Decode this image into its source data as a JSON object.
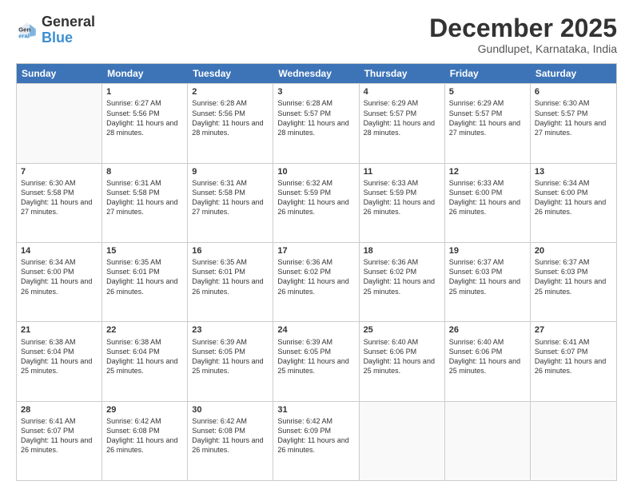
{
  "header": {
    "logo_general": "General",
    "logo_blue": "Blue",
    "month": "December 2025",
    "location": "Gundlupet, Karnataka, India"
  },
  "days_of_week": [
    "Sunday",
    "Monday",
    "Tuesday",
    "Wednesday",
    "Thursday",
    "Friday",
    "Saturday"
  ],
  "weeks": [
    [
      {
        "day": "",
        "empty": true
      },
      {
        "day": "1",
        "sunrise": "6:27 AM",
        "sunset": "5:56 PM",
        "daylight": "11 hours and 28 minutes."
      },
      {
        "day": "2",
        "sunrise": "6:28 AM",
        "sunset": "5:56 PM",
        "daylight": "11 hours and 28 minutes."
      },
      {
        "day": "3",
        "sunrise": "6:28 AM",
        "sunset": "5:57 PM",
        "daylight": "11 hours and 28 minutes."
      },
      {
        "day": "4",
        "sunrise": "6:29 AM",
        "sunset": "5:57 PM",
        "daylight": "11 hours and 28 minutes."
      },
      {
        "day": "5",
        "sunrise": "6:29 AM",
        "sunset": "5:57 PM",
        "daylight": "11 hours and 27 minutes."
      },
      {
        "day": "6",
        "sunrise": "6:30 AM",
        "sunset": "5:57 PM",
        "daylight": "11 hours and 27 minutes."
      }
    ],
    [
      {
        "day": "7",
        "sunrise": "6:30 AM",
        "sunset": "5:58 PM",
        "daylight": "11 hours and 27 minutes."
      },
      {
        "day": "8",
        "sunrise": "6:31 AM",
        "sunset": "5:58 PM",
        "daylight": "11 hours and 27 minutes."
      },
      {
        "day": "9",
        "sunrise": "6:31 AM",
        "sunset": "5:58 PM",
        "daylight": "11 hours and 27 minutes."
      },
      {
        "day": "10",
        "sunrise": "6:32 AM",
        "sunset": "5:59 PM",
        "daylight": "11 hours and 26 minutes."
      },
      {
        "day": "11",
        "sunrise": "6:33 AM",
        "sunset": "5:59 PM",
        "daylight": "11 hours and 26 minutes."
      },
      {
        "day": "12",
        "sunrise": "6:33 AM",
        "sunset": "6:00 PM",
        "daylight": "11 hours and 26 minutes."
      },
      {
        "day": "13",
        "sunrise": "6:34 AM",
        "sunset": "6:00 PM",
        "daylight": "11 hours and 26 minutes."
      }
    ],
    [
      {
        "day": "14",
        "sunrise": "6:34 AM",
        "sunset": "6:00 PM",
        "daylight": "11 hours and 26 minutes."
      },
      {
        "day": "15",
        "sunrise": "6:35 AM",
        "sunset": "6:01 PM",
        "daylight": "11 hours and 26 minutes."
      },
      {
        "day": "16",
        "sunrise": "6:35 AM",
        "sunset": "6:01 PM",
        "daylight": "11 hours and 26 minutes."
      },
      {
        "day": "17",
        "sunrise": "6:36 AM",
        "sunset": "6:02 PM",
        "daylight": "11 hours and 26 minutes."
      },
      {
        "day": "18",
        "sunrise": "6:36 AM",
        "sunset": "6:02 PM",
        "daylight": "11 hours and 25 minutes."
      },
      {
        "day": "19",
        "sunrise": "6:37 AM",
        "sunset": "6:03 PM",
        "daylight": "11 hours and 25 minutes."
      },
      {
        "day": "20",
        "sunrise": "6:37 AM",
        "sunset": "6:03 PM",
        "daylight": "11 hours and 25 minutes."
      }
    ],
    [
      {
        "day": "21",
        "sunrise": "6:38 AM",
        "sunset": "6:04 PM",
        "daylight": "11 hours and 25 minutes."
      },
      {
        "day": "22",
        "sunrise": "6:38 AM",
        "sunset": "6:04 PM",
        "daylight": "11 hours and 25 minutes."
      },
      {
        "day": "23",
        "sunrise": "6:39 AM",
        "sunset": "6:05 PM",
        "daylight": "11 hours and 25 minutes."
      },
      {
        "day": "24",
        "sunrise": "6:39 AM",
        "sunset": "6:05 PM",
        "daylight": "11 hours and 25 minutes."
      },
      {
        "day": "25",
        "sunrise": "6:40 AM",
        "sunset": "6:06 PM",
        "daylight": "11 hours and 25 minutes."
      },
      {
        "day": "26",
        "sunrise": "6:40 AM",
        "sunset": "6:06 PM",
        "daylight": "11 hours and 25 minutes."
      },
      {
        "day": "27",
        "sunrise": "6:41 AM",
        "sunset": "6:07 PM",
        "daylight": "11 hours and 26 minutes."
      }
    ],
    [
      {
        "day": "28",
        "sunrise": "6:41 AM",
        "sunset": "6:07 PM",
        "daylight": "11 hours and 26 minutes."
      },
      {
        "day": "29",
        "sunrise": "6:42 AM",
        "sunset": "6:08 PM",
        "daylight": "11 hours and 26 minutes."
      },
      {
        "day": "30",
        "sunrise": "6:42 AM",
        "sunset": "6:08 PM",
        "daylight": "11 hours and 26 minutes."
      },
      {
        "day": "31",
        "sunrise": "6:42 AM",
        "sunset": "6:09 PM",
        "daylight": "11 hours and 26 minutes."
      },
      {
        "day": "",
        "empty": true
      },
      {
        "day": "",
        "empty": true
      },
      {
        "day": "",
        "empty": true
      }
    ]
  ]
}
